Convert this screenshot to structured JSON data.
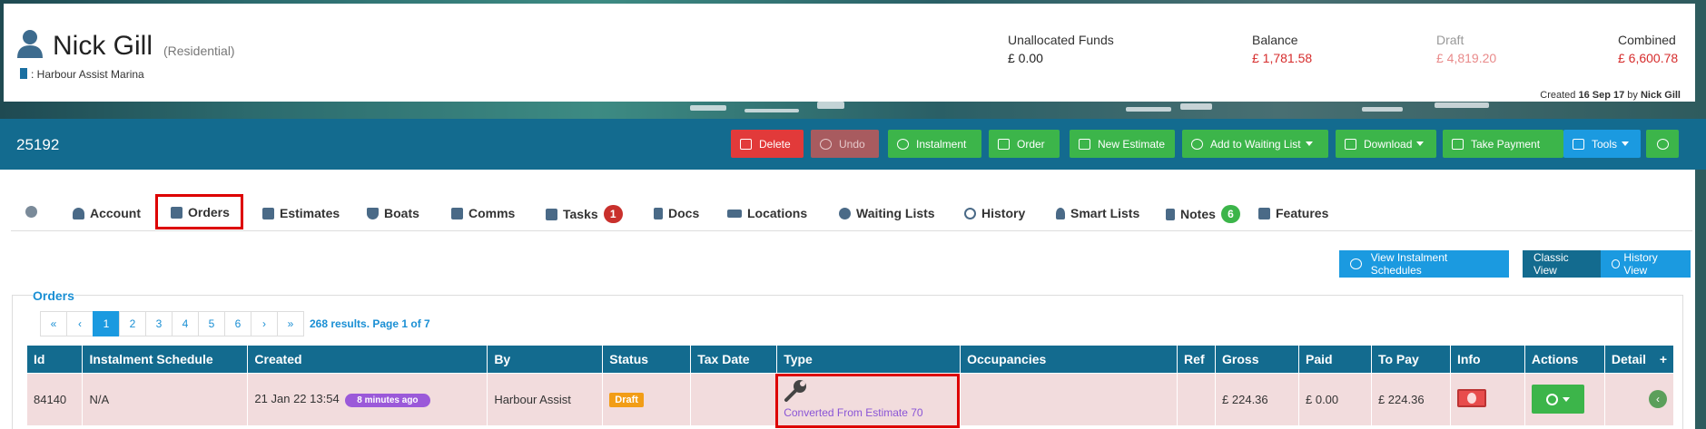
{
  "header": {
    "name": "Nick Gill",
    "type": "(Residential)",
    "marina": ": Harbour Assist Marina",
    "finance": [
      {
        "label": "Unallocated Funds",
        "value": "£ 0.00",
        "color": "#222222"
      },
      {
        "label": "Balance",
        "value": "£ 1,781.58",
        "color": "#d62c2c"
      },
      {
        "label": "Draft",
        "value": "£ 4,819.20",
        "color": "#e98a8a"
      },
      {
        "label": "Combined",
        "value": "£ 6,600.78",
        "color": "#d62c2c"
      }
    ],
    "created_prefix": "Created",
    "created_date": "16 Sep 17",
    "created_by_prefix": "by",
    "created_by": "Nick Gill"
  },
  "toolbar": {
    "order_id": "25192",
    "delete": "Delete",
    "undo": "Undo",
    "instalment": "Instalment",
    "order": "Order",
    "new_estimate": "New Estimate",
    "add_waiting": "Add to Waiting List",
    "download": "Download",
    "take_payment": "Take Payment",
    "tools": "Tools"
  },
  "tabs": {
    "account": "Account",
    "orders": "Orders",
    "estimates": "Estimates",
    "boats": "Boats",
    "comms": "Comms",
    "tasks": "Tasks",
    "tasks_count": "1",
    "docs": "Docs",
    "locations": "Locations",
    "waiting_lists": "Waiting Lists",
    "history": "History",
    "smart_lists": "Smart Lists",
    "notes": "Notes",
    "notes_count": "6",
    "features": "Features"
  },
  "view": {
    "instalment_schedules": "View Instalment Schedules",
    "classic": "Classic View",
    "history": "History View"
  },
  "orders": {
    "title": "Orders",
    "pager": [
      "«",
      "‹",
      "1",
      "2",
      "3",
      "4",
      "5",
      "6",
      "›",
      "»"
    ],
    "results": "268 results. Page 1 of 7",
    "columns": {
      "id": "Id",
      "instalment": "Instalment Schedule",
      "created": "Created",
      "by": "By",
      "status": "Status",
      "tax_date": "Tax Date",
      "type": "Type",
      "occupancies": "Occupancies",
      "ref": "Ref",
      "gross": "Gross",
      "paid": "Paid",
      "to_pay": "To Pay",
      "info": "Info",
      "actions": "Actions",
      "detail": "Detail",
      "add": "+"
    },
    "row": {
      "id": "84140",
      "instalment": "N/A",
      "created": "21 Jan 22 13:54",
      "ago": "8 minutes ago",
      "by": "Harbour Assist",
      "status": "Draft",
      "type_note": "Converted From Estimate 70",
      "gross": "£ 224.36",
      "paid": "£ 0.00",
      "to_pay": "£ 224.36",
      "detail": "‹"
    }
  }
}
